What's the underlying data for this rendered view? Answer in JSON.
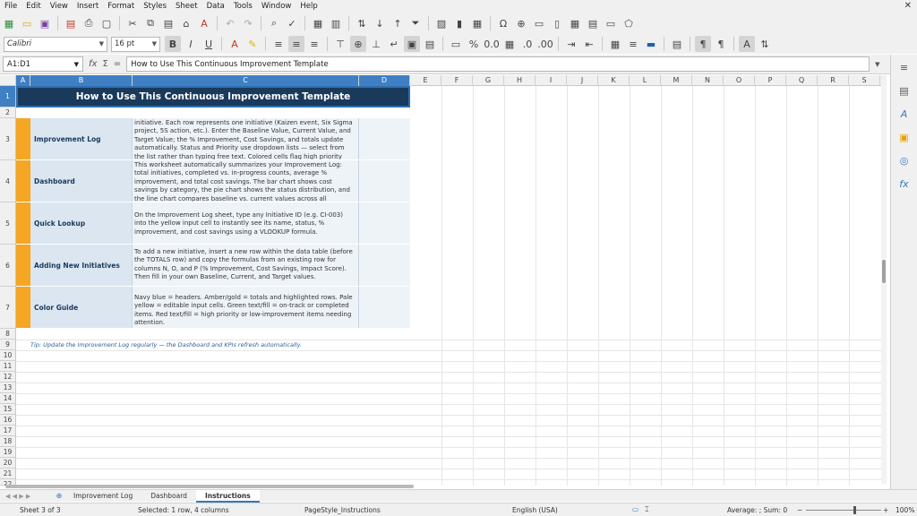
{
  "menu": [
    "File",
    "Edit",
    "View",
    "Insert",
    "Format",
    "Styles",
    "Sheet",
    "Data",
    "Tools",
    "Window",
    "Help"
  ],
  "format_bar": {
    "font_name": "Calibri",
    "font_size": "16 pt"
  },
  "formula_bar": {
    "name_box": "A1:D1",
    "content": "How to Use This Continuous Improvement Template"
  },
  "columns": [
    "A",
    "B",
    "C",
    "D",
    "E",
    "F",
    "G",
    "H",
    "I",
    "J",
    "K",
    "L",
    "M",
    "N",
    "O",
    "P",
    "Q",
    "R",
    "S"
  ],
  "rows": [
    "1",
    "2",
    "3",
    "4",
    "5",
    "6",
    "7",
    "8",
    "9",
    "10",
    "11",
    "12",
    "13",
    "14",
    "15",
    "16",
    "17",
    "18",
    "19",
    "20",
    "21",
    "22"
  ],
  "sheet": {
    "title": "How to Use This Continuous Improvement Template",
    "sections": [
      {
        "label": "Improvement Log",
        "text": "initiative. Each row represents one initiative (Kaizen event, Six Sigma project, 5S action, etc.). Enter the Baseline Value, Current Value, and Target Value; the % Improvement, Cost Savings, and totals update automatically. Status and Priority use dropdown lists — select from the list rather than typing free text. Colored cells flag high priority items and items with low % improvement"
      },
      {
        "label": "Dashboard",
        "text": "This worksheet automatically summarizes your Improvement Log: total initiatives, completed vs. in-progress counts, average % improvement, and total cost savings. The bar chart shows cost savings by category, the pie chart shows the status distribution, and the line chart compares baseline vs. current values across all initiatives. No manual entry is needed here — everything pulls from the Improvement Log sheet."
      },
      {
        "label": "Quick Lookup",
        "text": "On the Improvement Log sheet, type any Initiative ID (e.g. CI-003) into the yellow input cell to instantly see its name, status, % improvement, and cost savings using a VLOOKUP formula."
      },
      {
        "label": "Adding New Initiatives",
        "text": "To add a new initiative, insert a new row within the data table (before the TOTALS row) and copy the formulas from an existing row for columns N, O, and P (% Improvement, Cost Savings, Impact Score). Then fill in your own Baseline, Current, and Target values."
      },
      {
        "label": "Color Guide",
        "text": "Navy blue = headers. Amber/gold = totals and highlighted rows. Pale yellow = editable input cells. Green text/fill = on-track or completed items. Red text/fill = high priority or low-improvement items needing attention."
      }
    ],
    "tip": "Tip: Update the Improvement Log regularly — the Dashboard and KPIs refresh automatically."
  },
  "tabs": [
    "Improvement Log",
    "Dashboard",
    "Instructions"
  ],
  "active_tab": "Instructions",
  "status": {
    "sheet": "Sheet 3 of 3",
    "selection": "Selected: 1 row, 4 columns",
    "page_style": "PageStyle_Instructions",
    "language": "English (USA)",
    "summary": "Average: ; Sum: 0",
    "zoom": "100%"
  },
  "colors": {
    "navy": "#1a3a5c",
    "amber": "#f5a623",
    "pale_blue": "#dbe6f1",
    "select_blue": "#3f7fc4"
  }
}
